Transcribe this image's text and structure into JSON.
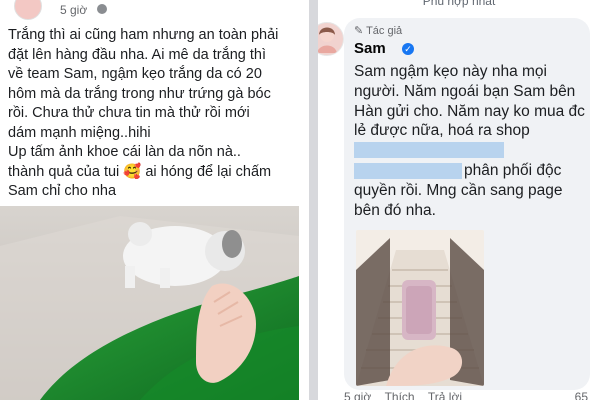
{
  "post": {
    "time": "5 giờ",
    "lines": [
      "Trắng thì ai cũng ham nhưng an toàn phải",
      "đặt lên hàng đầu nha. Ai mê da trắng thì",
      "về team Sam, ngậm kẹo trắng da có 20",
      "hôm mà da trắng trong như trứng gà bóc",
      "rồi. Chưa thử chưa tin mà thử rồi mới",
      "dám mạnh miệng..hihi",
      "Up tấm ảnh khoe cái làn da nõn nà..",
      "thành quả của tui 🥰 ai hóng để lại chấm",
      "Sam chỉ cho nha"
    ]
  },
  "comment": {
    "sort_label": "Phù hợp nhất",
    "author_tag": "Tác giả",
    "author": "Sam",
    "lines": [
      "Sam ngậm kẹo này nha mọi",
      "người. Năm ngoái bạn Sam bên",
      "Hàn gửi cho. Năm nay ko mua đc",
      "lẻ được nữa, hoá ra shop",
      "",
      "phân phối độc",
      "quyền rồi. Mng cần sang page",
      "bên đó nha."
    ],
    "meta": {
      "time": "5 giờ",
      "like": "Thích",
      "reply": "Trả lời",
      "reactions": "65"
    }
  },
  "colors": {
    "accent": "#1877f2",
    "green_fabric": "#1f8a2e",
    "redaction": "#b8d3ee"
  }
}
